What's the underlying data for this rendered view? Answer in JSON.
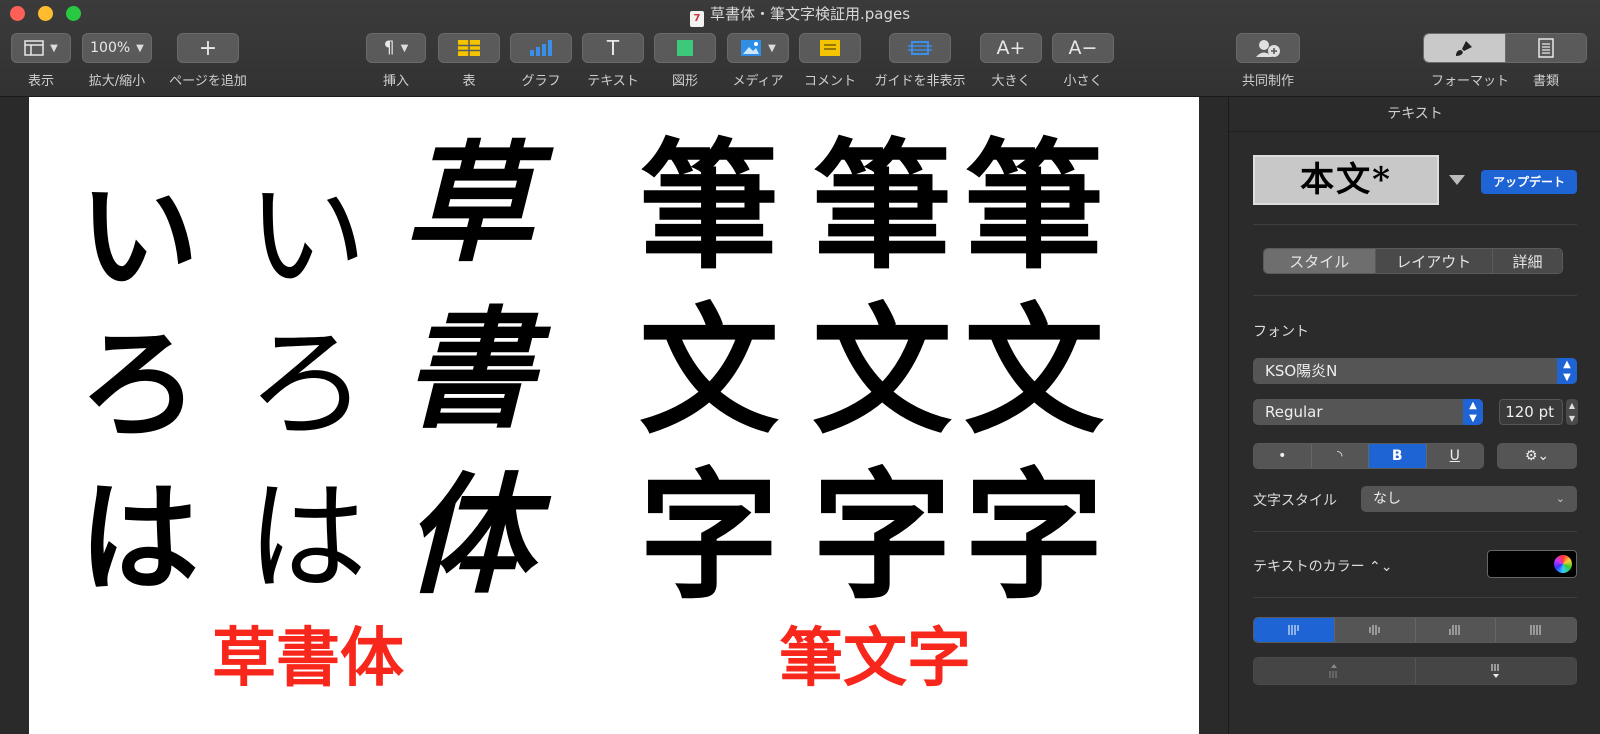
{
  "window": {
    "title": "草書体・筆文字検証用.pages",
    "doc_icon": "7"
  },
  "toolbar": {
    "view": {
      "label": "表示",
      "icon": "sidebar-icon"
    },
    "zoom": {
      "label": "拡大/縮小",
      "value": "100%"
    },
    "add_page": {
      "label": "ページを追加",
      "glyph": "+"
    },
    "insert": {
      "label": "挿入",
      "glyph": "¶"
    },
    "table": {
      "label": "表"
    },
    "chart": {
      "label": "グラフ"
    },
    "text": {
      "label": "テキスト",
      "glyph": "T"
    },
    "shape": {
      "label": "図形"
    },
    "media": {
      "label": "メディア"
    },
    "comment": {
      "label": "コメント"
    },
    "guides": {
      "label": "ガイドを非表示"
    },
    "bigger": {
      "label": "大きく",
      "glyph": "A+"
    },
    "smaller": {
      "label": "小さく",
      "glyph": "A−"
    },
    "collaborate": {
      "label": "共同制作"
    },
    "format": {
      "label": "フォーマット"
    },
    "document": {
      "label": "書類"
    }
  },
  "page": {
    "kana_columns": [
      [
        "い",
        "ろ",
        "は"
      ],
      [
        "い",
        "ろ",
        "は"
      ]
    ],
    "sousho_column": [
      "草",
      "書",
      "体"
    ],
    "fude_columns": [
      [
        "筆",
        "文",
        "字"
      ],
      [
        "筆",
        "文",
        "字"
      ],
      [
        "筆",
        "文",
        "字"
      ]
    ],
    "label_left": "草書体",
    "label_right": "筆文字",
    "label_color": "#f7271c"
  },
  "sidebar": {
    "header": "テキスト",
    "paragraph_style_preview": "本文*",
    "update_button": "アップデート",
    "tabs": [
      "スタイル",
      "レイアウト",
      "詳細"
    ],
    "font_label": "フォント",
    "font_name": "KSO陽炎N",
    "font_style": "Regular",
    "font_size": "120 pt",
    "format_buttons": [
      "•",
      "◝",
      "B",
      "U"
    ],
    "gear_label": "⚙︎⌄",
    "char_style_label": "文字スタイル",
    "char_style_value": "なし",
    "text_color_label": "テキストのカラー ⌃⌄",
    "text_color": "#000000",
    "accent": "#1e64d4"
  }
}
